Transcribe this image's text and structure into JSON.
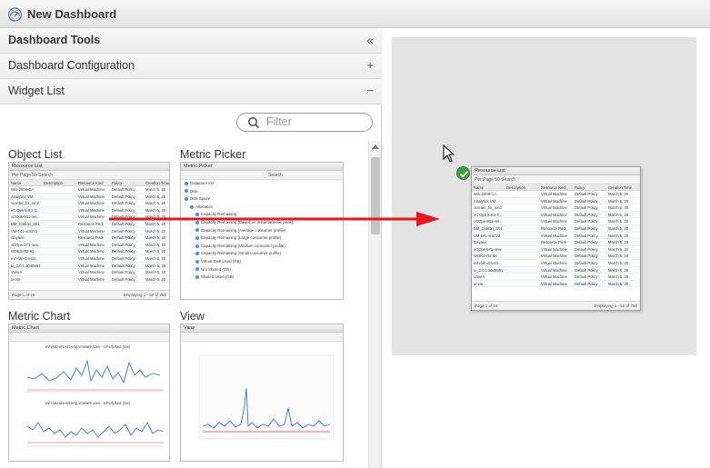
{
  "window": {
    "title": "New Dashboard",
    "icon": "dashboard-gauge-icon"
  },
  "sidebar": {
    "tools_title": "Dashboard Tools",
    "collapse_glyph": "«",
    "sections": [
      {
        "label": "Dashboard Configuration",
        "control": "+"
      },
      {
        "label": "Widget List",
        "control": "−"
      }
    ],
    "filter_placeholder": "Filter"
  },
  "widgets": [
    {
      "name": "Object List"
    },
    {
      "name": "Metric Picker"
    },
    {
      "name": "Metric Chart"
    },
    {
      "name": "View"
    }
  ],
  "resource_list": {
    "title": "Resource List",
    "toolbar": "Per Page  50   Search",
    "columns": [
      "Name",
      "Description",
      "Resource Kind",
      "Policy",
      "Creation Time"
    ],
    "rows": [
      [
        "Win-2008-CA",
        "",
        "Virtual Machine",
        "Default Policy",
        "March 5, 20"
      ],
      [
        "Analytics VM",
        "",
        "Virtual Machine",
        "Default Policy",
        "March 5, 20"
      ],
      [
        "vcenter_fix_run2",
        "",
        "Virtual Machine",
        "Default Policy",
        "March 5, 20"
      ],
      [
        "vC Ops 5.8.2 C...",
        "",
        "Virtual Machine",
        "Default Policy",
        "March 5, 20"
      ],
      [
        "vCOps-561-net...",
        "",
        "Virtual Machine",
        "Default Policy",
        "March 5, 20"
      ],
      [
        "BM_Clarion_S01",
        "",
        "Resource Pool",
        "Default Policy",
        "March 5, 20"
      ],
      [
        "VM-141-vra1V2",
        "",
        "Virtual Machine",
        "Default Policy",
        "March 5, 20"
      ],
      [
        "Gayane",
        "",
        "Resource Pool",
        "Default Policy",
        "March 5, 20"
      ],
      [
        "vCOps-571-new",
        "",
        "Virtual Machine",
        "Default Policy",
        "March 5, 20"
      ],
      [
        "WOKS-R2-64",
        "",
        "Virtual Machine",
        "Default Policy",
        "March 5, 20"
      ],
      [
        "evn-lab-dm-64...",
        "",
        "Virtual Machine",
        "Default Policy",
        "March 5, 20"
      ],
      [
        "Li_2.0.1.1045591",
        "",
        "Virtual Machine",
        "Default Policy",
        "March 5, 20"
      ],
      [
        "VaneA",
        "",
        "Virtual Machine",
        "Default Policy",
        "March 5, 20"
      ],
      [
        "ui-vm",
        "",
        "Virtual Machine",
        "Default Policy",
        "March 5, 20"
      ]
    ],
    "footer_left": "Page 1 of 16",
    "footer_right": "Displaying 1 - 50 of 756"
  },
  "metric_picker": {
    "title": "Metric Picker",
    "search_label": "Search",
    "items": [
      "Datastore I/O",
      "Disk",
      "Disk Space",
      "Allocation",
      "Capacity Remaining",
      "Capacity Remaining (Based on instantaneous peak)",
      "Capacity Remaining (Average consumer profile)",
      "Capacity Remaining (Large consumer profile)",
      "Capacity Remaining (Medium consumer profile)",
      "Capacity Remaining (Small consumer profile)",
      "Virtual Disk Used (GB)",
      "Not Shared (GB)",
      "Shared Used (GB)"
    ]
  },
  "metric_chart": {
    "title": "Metric Chart",
    "chart1_caption": "evn-lab-dm-64.eng.vmware.com - CPU|Used (ms)",
    "chart2_caption": "evn-lab-dm-64.eng.vmware.com - CPU|Used (ms)"
  },
  "view_widget": {
    "title": "View"
  },
  "colors": {
    "accent": "#e8161b",
    "badge": "#3ea13e",
    "canvas": "#e3e3e3"
  }
}
